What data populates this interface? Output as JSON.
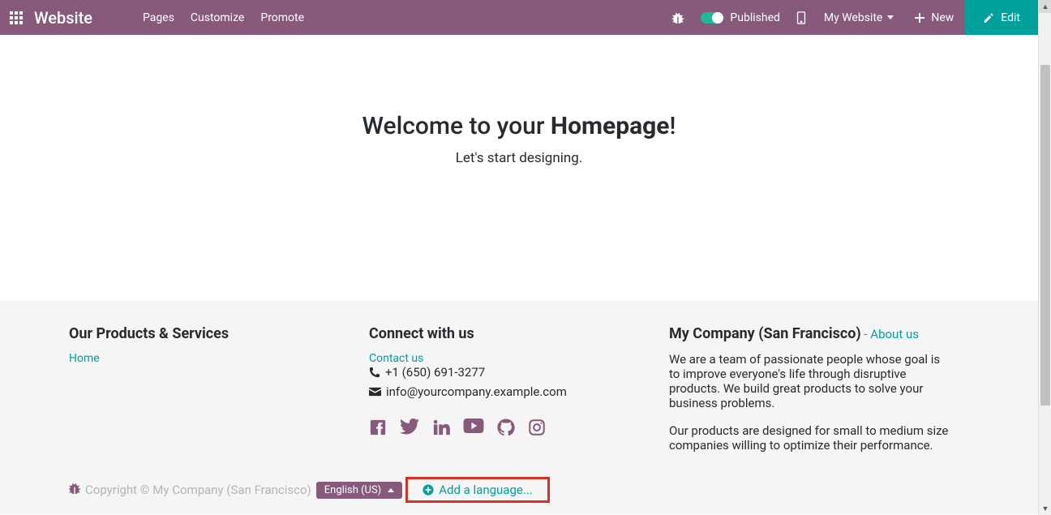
{
  "header": {
    "brand": "Website",
    "nav": {
      "pages": "Pages",
      "customize": "Customize",
      "promote": "Promote"
    },
    "published_label": "Published",
    "website_dropdown": "My Website",
    "new_label": "New",
    "edit_label": "Edit"
  },
  "main": {
    "title_prefix": "Welcome to your ",
    "title_bold": "Homepage",
    "title_suffix": "!",
    "subtitle": "Let's start designing."
  },
  "footer": {
    "col1": {
      "heading": "Our Products & Services",
      "home_link": "Home"
    },
    "col2": {
      "heading": "Connect with us",
      "contact_link": "Contact us",
      "phone": "+1 (650) 691-3277",
      "email": "info@yourcompany.example.com"
    },
    "col3": {
      "heading": "My Company (San Francisco)",
      "about_sep": " - ",
      "about_link": "About us",
      "desc1": "We are a team of passionate people whose goal is to improve everyone's life through disruptive products. We build great products to solve your business problems.",
      "desc2": "Our products are designed for small to medium size companies willing to optimize their performance."
    }
  },
  "bottom": {
    "copyright": "Copyright © My Company (San Francisco)",
    "language": "English (US)",
    "add_language": "Add a language..."
  }
}
